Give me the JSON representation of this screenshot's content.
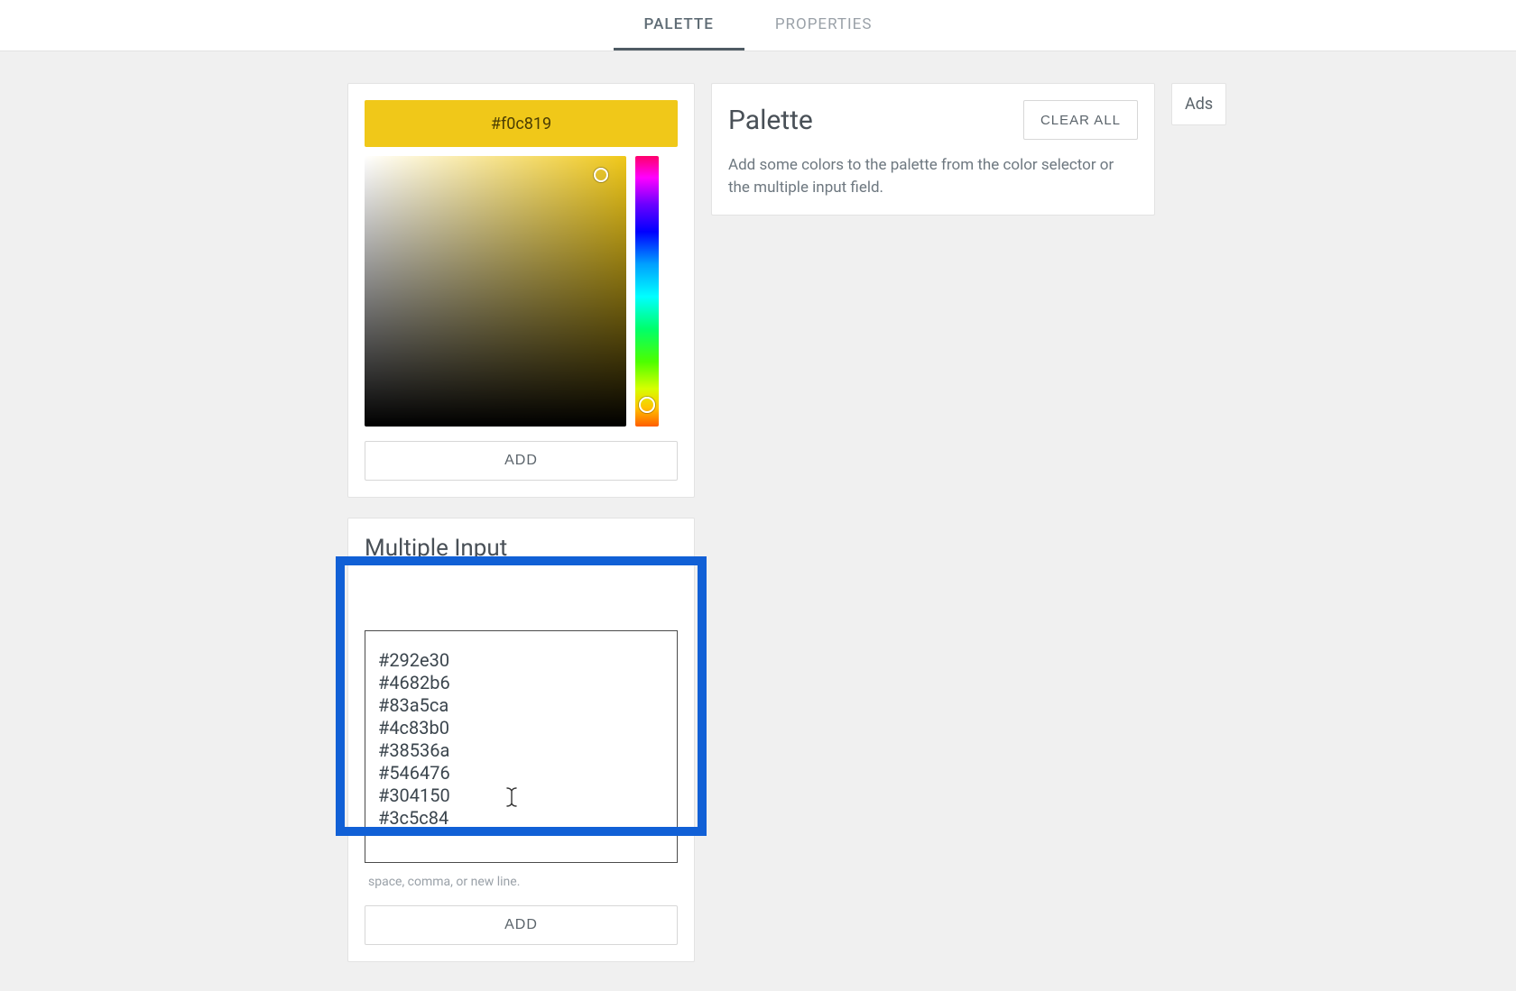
{
  "tabs": {
    "palette": "PALETTE",
    "properties": "PROPERTIES"
  },
  "color_picker": {
    "current_hex": "#f0c819",
    "header_bg": "#f0c819",
    "add_label": "ADD"
  },
  "multiple_input": {
    "title": "Multiple Input",
    "value": "#292e30\n#4682b6\n#83a5ca\n#4c83b0\n#38536a\n#546476\n#304150\n#3c5c84",
    "helper": "space, comma, or new line.",
    "add_label": "ADD"
  },
  "palette_panel": {
    "title": "Palette",
    "clear_label": "CLEAR ALL",
    "description": "Add some colors to the palette from the color selector or the multiple input field."
  },
  "ads": {
    "label": "Ads"
  }
}
